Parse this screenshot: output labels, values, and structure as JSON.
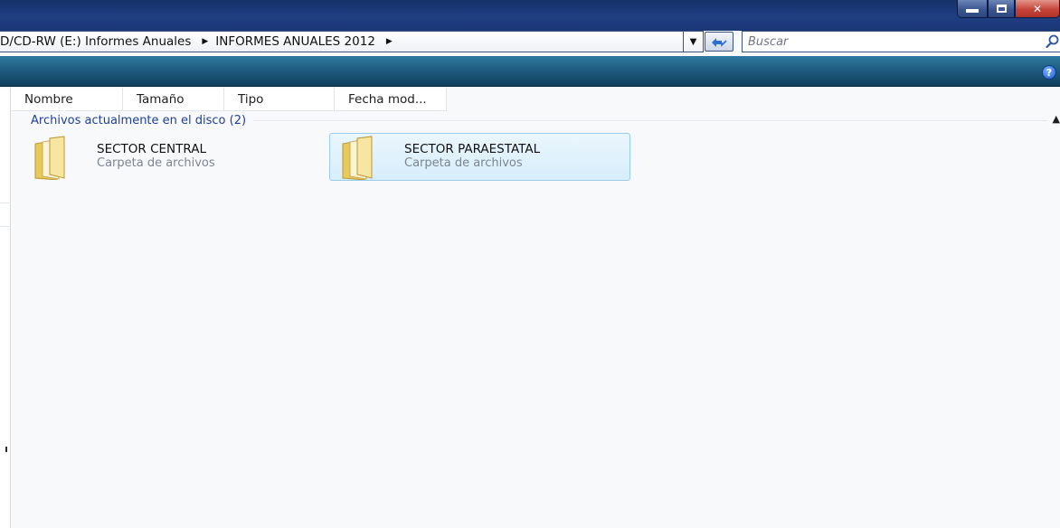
{
  "breadcrumb": {
    "items": [
      {
        "label": "D/CD-RW (E:) Informes Anuales"
      },
      {
        "label": "INFORMES ANUALES 2012"
      }
    ]
  },
  "search": {
    "placeholder": "Buscar"
  },
  "columns": [
    {
      "label": "Nombre"
    },
    {
      "label": "Tamaño"
    },
    {
      "label": "Tipo"
    },
    {
      "label": "Fecha mod..."
    }
  ],
  "group": {
    "title": "Archivos actualmente en el disco (2)"
  },
  "items": [
    {
      "name": "SECTOR CENTRAL",
      "type": "Carpeta de archivos",
      "selected": false
    },
    {
      "name": "SECTOR PARAESTATAL",
      "type": "Carpeta de archivos",
      "selected": true
    }
  ],
  "colors": {
    "title_bar": "#1f3f82",
    "toolbar": "#1d5a7e",
    "group_title": "#1e3f9a",
    "selection": "#d7eefb"
  },
  "icons": [
    "minimize-icon",
    "maximize-icon",
    "close-icon",
    "chevron-down-icon",
    "refresh-icon",
    "search-icon",
    "help-icon",
    "folder-icon",
    "collapse-icon"
  ]
}
